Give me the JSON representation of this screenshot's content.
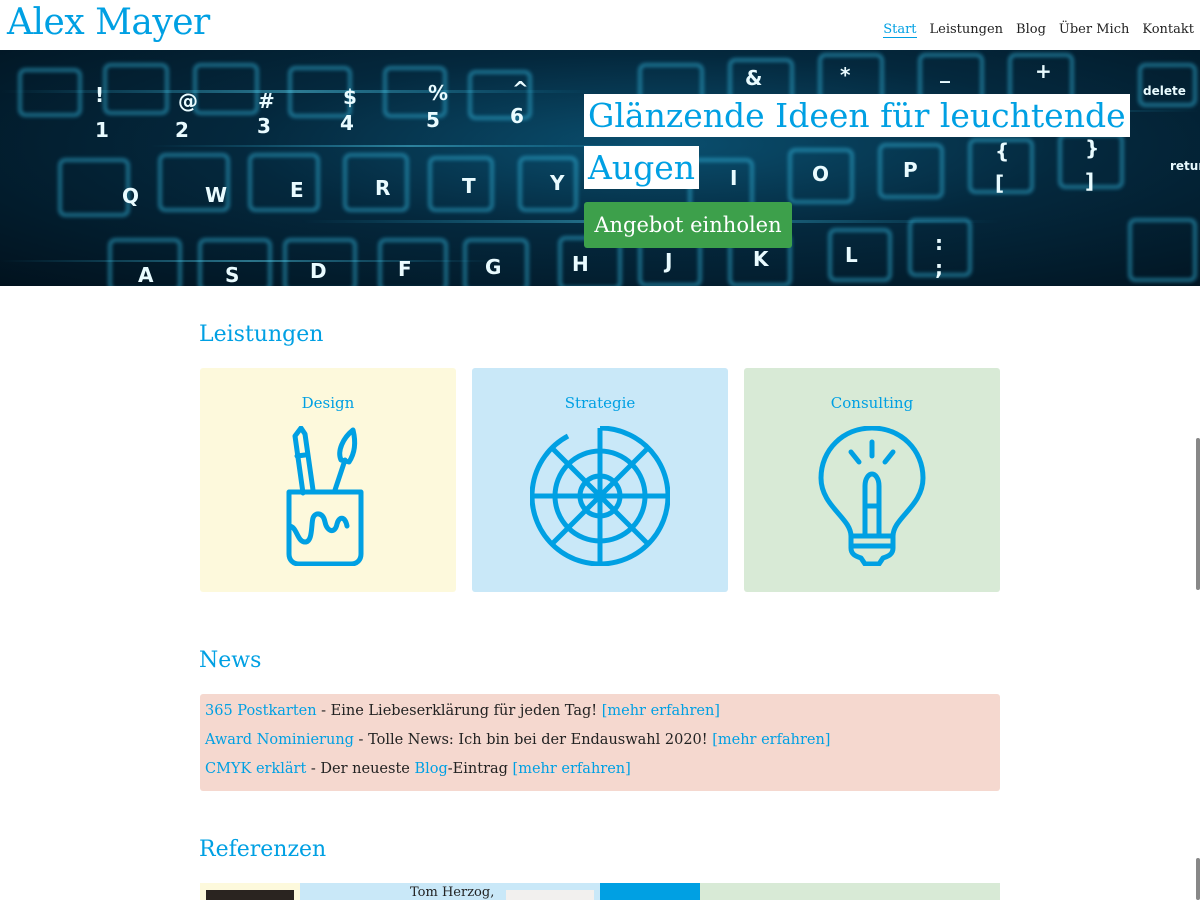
{
  "header": {
    "logo": "Alex Mayer",
    "nav": [
      "Start",
      "Leistungen",
      "Blog",
      "Über Mich",
      "Kontakt"
    ]
  },
  "hero": {
    "title_line1": "Glänzende Ideen für leuchtende",
    "title_line2": "Augen",
    "cta": "Angebot einholen"
  },
  "leistungen": {
    "title": "Leistungen",
    "cards": [
      {
        "label": "Design",
        "icon": "pen-brush-cup-icon",
        "color": "#fdf9dc"
      },
      {
        "label": "Strategie",
        "icon": "target-wheel-icon",
        "color": "#c9e8f8"
      },
      {
        "label": "Consulting",
        "icon": "lightbulb-icon",
        "color": "#d8ead6"
      }
    ]
  },
  "news": {
    "title": "News",
    "items": [
      {
        "link": "365 Postkarten",
        "text": " - Eine Liebeserklärung für jeden Tag! ",
        "more": "[mehr erfahren]"
      },
      {
        "link": "Award Nominierung",
        "text": " - Tolle News: Ich bin bei der Endauswahl 2020! ",
        "more": "[mehr erfahren]"
      },
      {
        "link": "CMYK erklärt",
        "text_a": " - Der neueste ",
        "inline_link": "Blog",
        "text_b": "-Eintrag ",
        "more": "[mehr erfahren]"
      }
    ]
  },
  "referenzen": {
    "title": "Referenzen",
    "partial_name": "Tom Herzog,"
  },
  "colors": {
    "accent": "#00a0e3",
    "cta": "#3da04b",
    "news_bg": "#f5d8cf"
  }
}
